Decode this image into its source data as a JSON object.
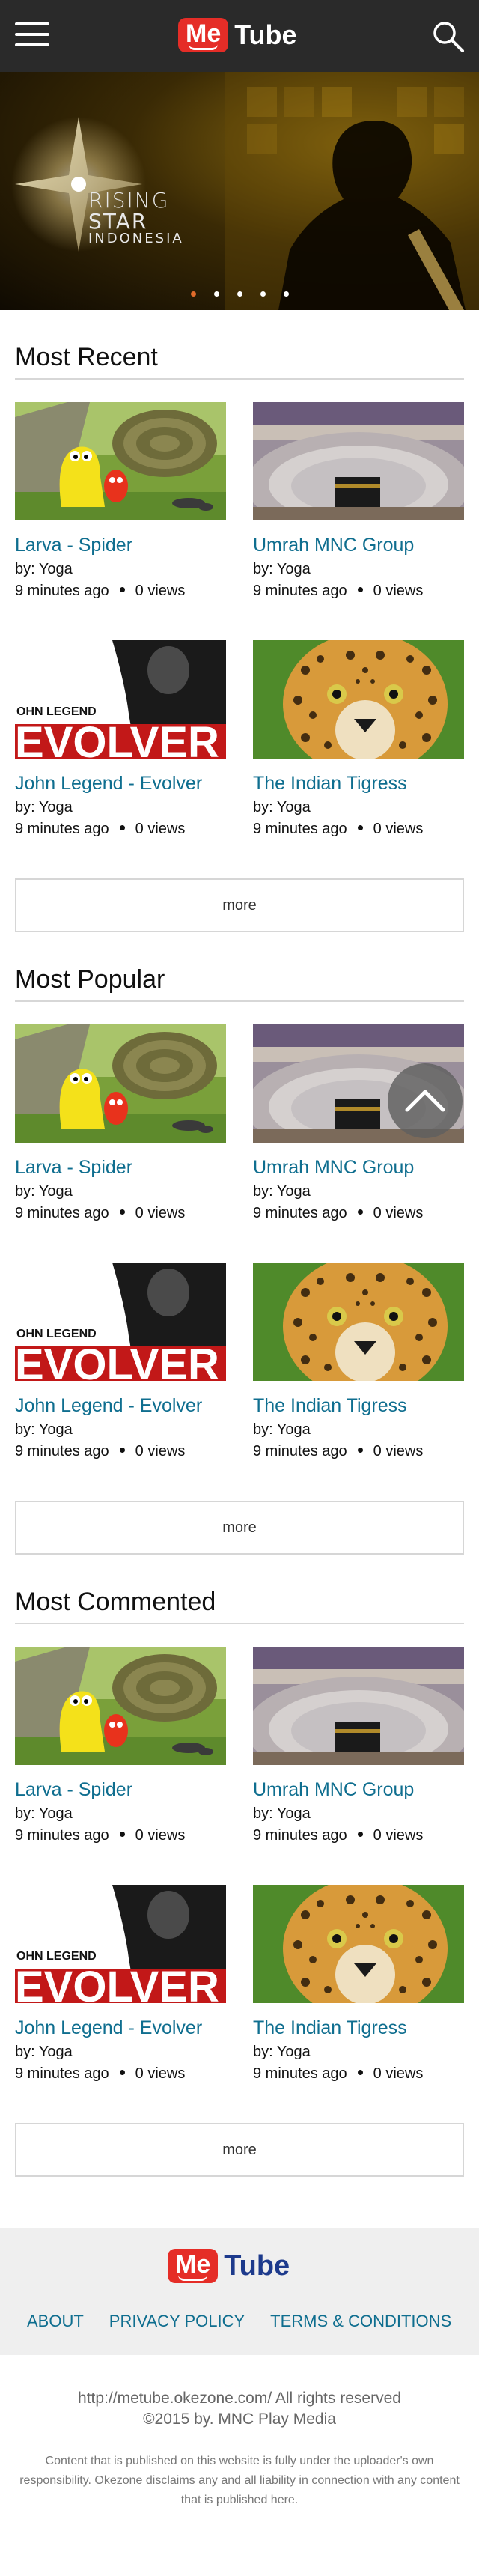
{
  "header": {
    "logo_me": "Me",
    "logo_tube": "Tube"
  },
  "hero": {
    "line1": "RISING",
    "line2": "STAR",
    "line3": "INDONESIA",
    "slides": 5,
    "active_slide": 1
  },
  "videos": [
    {
      "title": "Larva - Spider",
      "by": "by: Yoga",
      "age": "9 minutes ago",
      "views": "0 views",
      "thumb": "larva"
    },
    {
      "title": "Umrah MNC Group",
      "by": "by: Yoga",
      "age": "9 minutes ago",
      "views": "0 views",
      "thumb": "kaaba"
    },
    {
      "title": "John Legend - Evolver",
      "by": "by: Yoga",
      "age": "9 minutes ago",
      "views": "0 views",
      "thumb": "evolver"
    },
    {
      "title": "The Indian Tigress",
      "by": "by: Yoga",
      "age": "9 minutes ago",
      "views": "0 views",
      "thumb": "leopard"
    }
  ],
  "sections": [
    {
      "title": "Most Recent",
      "more": "more"
    },
    {
      "title": "Most Popular",
      "more": "more"
    },
    {
      "title": "Most Commented",
      "more": "more"
    }
  ],
  "thumb_text": {
    "evolver_small": "OHN LEGEND",
    "evolver_big": "EVOLVER"
  },
  "footer": {
    "logo_me": "Me",
    "logo_tube": "Tube",
    "links": [
      "ABOUT",
      "PRIVACY POLICY",
      "TERMS & CONDITIONS"
    ],
    "copyright_line1": "http://metube.okezone.com/ All rights reserved",
    "copyright_line2": "©2015 by. MNC Play Media",
    "disclaimer": "Content that is published on this website is fully under the uploader's own responsibility. Okezone disclaims any and all liability in connection with any content that is published here."
  },
  "colors": {
    "header_bg": "#2a2a2a",
    "brand_red": "#e52d27",
    "link_blue": "#0f6e8f",
    "footer_logo_blue": "#1d3a8c",
    "active_dot": "#e06b2b"
  },
  "icons": {
    "menu": "hamburger-icon",
    "search": "search-icon",
    "scroll_top": "chevron-up-icon"
  }
}
